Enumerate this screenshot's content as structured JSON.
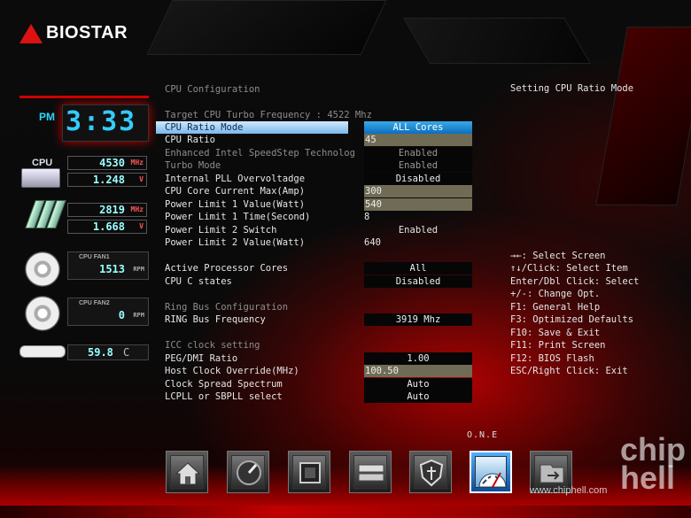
{
  "brand": {
    "name": "BIOSTAR"
  },
  "status": {
    "clock_period": "PM",
    "clock_time": "3:33",
    "cpu_label": "CPU",
    "cpu_freq": "4530",
    "cpu_freq_unit": "MHz",
    "cpu_voltage": "1.248",
    "cpu_voltage_unit": "V",
    "mem_freq": "2819",
    "mem_freq_unit": "MHz",
    "mem_voltage": "1.668",
    "mem_voltage_unit": "V",
    "fan1_name": "CPU FAN1",
    "fan1_rpm": "1513",
    "fan1_unit": "RPM",
    "fan2_name": "CPU FAN2",
    "fan2_rpm": "0",
    "fan2_unit": "RPM",
    "temperature": "59.8",
    "temperature_unit": "C"
  },
  "settings": {
    "section_title": "CPU Configuration",
    "target_turbo": "Target CPU Turbo Frequency : 4522 Mhz",
    "ratio_mode_label": "CPU Ratio Mode",
    "ratio_mode_value": "ALL Cores",
    "ratio_label": "CPU Ratio",
    "ratio_value": "45",
    "speedstep_label": "Enhanced Intel SpeedStep Technolog",
    "speedstep_value": "Enabled",
    "turbo_label": "Turbo Mode",
    "turbo_value": "Enabled",
    "pll_label": "Internal PLL Overvoltadge",
    "pll_value": "Disabled",
    "core_current_label": "CPU Core Current Max(Amp)",
    "core_current_value": "300",
    "pl1_value_label": "Power Limit 1 Value(Watt)",
    "pl1_value_value": "540",
    "pl1_time_label": "Power Limit 1 Time(Second)",
    "pl1_time_value": "8",
    "pl2_switch_label": "Power Limit 2 Switch",
    "pl2_switch_value": "Enabled",
    "pl2_value_label": "Power Limit 2 Value(Watt)",
    "pl2_value_value": "640",
    "active_cores_label": "Active Processor Cores",
    "active_cores_value": "All",
    "cstates_label": "CPU C states",
    "cstates_value": "Disabled",
    "ring_title": "Ring Bus Configuration",
    "ring_freq_label": "RING Bus Frequency",
    "ring_freq_value": "3919 Mhz",
    "icc_title": "ICC clock setting",
    "peg_label": "PEG/DMI Ratio",
    "peg_value": "1.00",
    "host_clock_label": "Host Clock Override(MHz)",
    "host_clock_value": "100.50",
    "spread_label": "Clock Spread Spectrum",
    "spread_value": "Auto",
    "lcpll_label": "LCPLL or SBPLL select",
    "lcpll_value": "Auto"
  },
  "help": {
    "description": "Setting CPU Ratio Mode",
    "keys": [
      "→←: Select Screen",
      "↑↓/Click: Select Item",
      "Enter/Dbl Click: Select",
      "+/-: Change Opt.",
      "F1: General Help",
      "F3: Optimized Defaults",
      "F10: Save & Exit",
      "F11: Print Screen",
      "F12: BIOS Flash",
      "ESC/Right Click: Exit"
    ]
  },
  "nav": {
    "active_label": "O.N.E",
    "buttons": [
      "home-icon",
      "performance-icon",
      "chipset-icon",
      "storage-icon",
      "security-icon",
      "one-icon",
      "exit-icon"
    ],
    "active_index": 5
  },
  "watermark": {
    "logo": "chip hell",
    "url": "www.chiphell.com"
  },
  "colors": {
    "accent_red": "#c00000",
    "selection_blue": "#1a7fd0",
    "digit_cyan": "#33ccff"
  }
}
